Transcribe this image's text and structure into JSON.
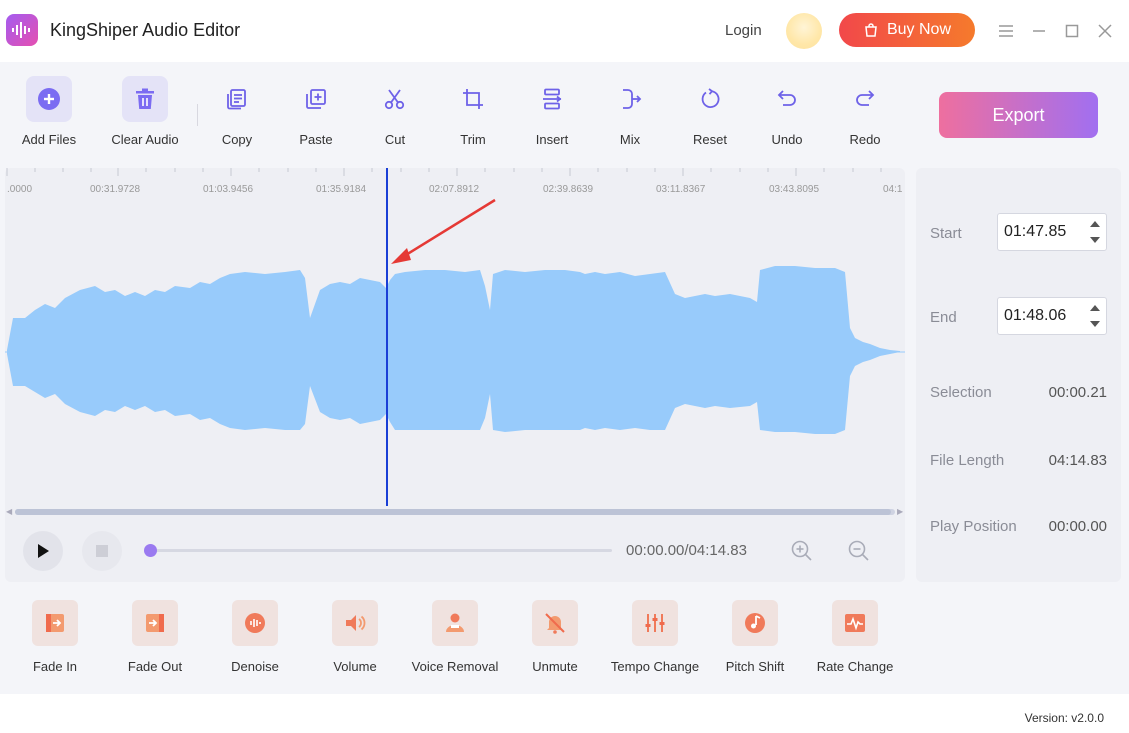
{
  "app": {
    "title": "KingShiper Audio Editor"
  },
  "header": {
    "login": "Login",
    "buy_now": "Buy Now"
  },
  "toolbar": {
    "add_files": "Add Files",
    "clear_audio": "Clear Audio",
    "copy": "Copy",
    "paste": "Paste",
    "cut": "Cut",
    "trim": "Trim",
    "insert": "Insert",
    "mix": "Mix",
    "reset": "Reset",
    "undo": "Undo",
    "redo": "Redo",
    "export": "Export"
  },
  "ruler": {
    "labels": [
      ".0000",
      "00:31.9728",
      "01:03.9456",
      "01:35.9184",
      "02:07.8912",
      "02:39.8639",
      "03:11.8367",
      "03:43.8095",
      "04:1"
    ]
  },
  "transport": {
    "time": "00:00.00/04:14.83"
  },
  "info": {
    "start_label": "Start",
    "start_value": "01:47.85",
    "end_label": "End",
    "end_value": "01:48.06",
    "selection_label": "Selection",
    "selection_value": "00:00.21",
    "file_length_label": "File Length",
    "file_length_value": "04:14.83",
    "play_position_label": "Play Position",
    "play_position_value": "00:00.00"
  },
  "effects": {
    "fade_in": "Fade In",
    "fade_out": "Fade Out",
    "denoise": "Denoise",
    "volume": "Volume",
    "voice_removal": "Voice Removal",
    "unmute": "Unmute",
    "tempo_change": "Tempo Change",
    "pitch_shift": "Pitch Shift",
    "rate_change": "Rate Change"
  },
  "footer": {
    "version": "Version: v2.0.0"
  },
  "colors": {
    "accent": "#9a7af0",
    "waveform": "#98cbfb",
    "playhead": "#1a3fd6",
    "buy": "#f2484a",
    "effect_icon": "#f07a5a"
  }
}
